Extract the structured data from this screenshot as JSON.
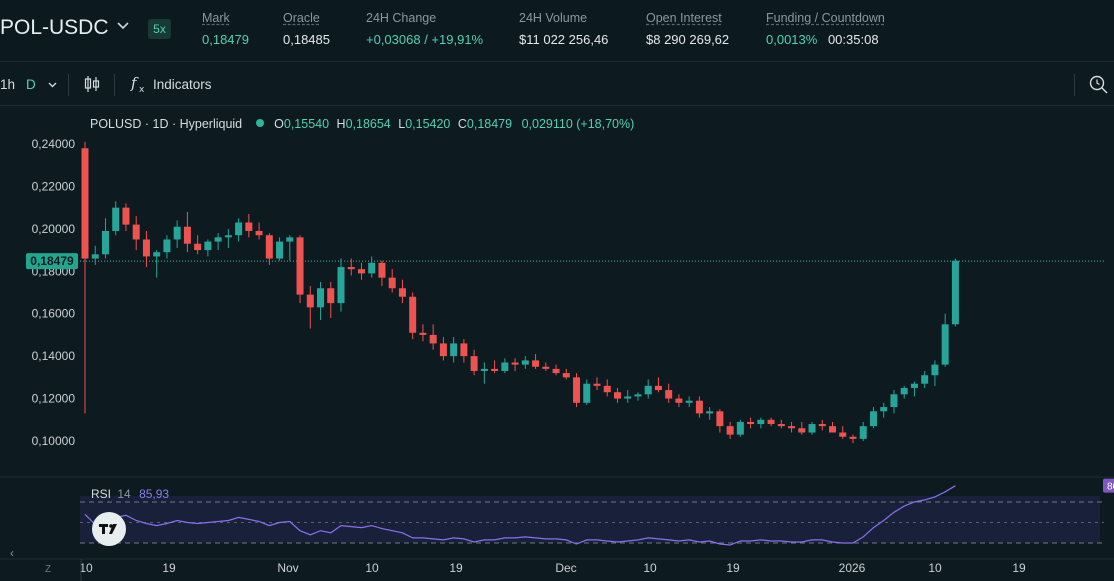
{
  "header": {
    "pair": "POL-USDC",
    "leverage": "5x",
    "stats": [
      {
        "label": "Mark",
        "value": "0,18479",
        "green": true
      },
      {
        "label": "Oracle",
        "value": "0,18485",
        "green": false
      },
      {
        "label": "24H Change",
        "value": "+0,03068 / +19,91%",
        "green": true
      },
      {
        "label": "24H Volume",
        "value": "$11 022 256,46",
        "green": false
      },
      {
        "label": "Open Interest",
        "value": "$8 290 269,62",
        "green": false
      },
      {
        "label": "Funding / Countdown",
        "value": "0,0013%",
        "value2": "00:35:08",
        "green": true
      }
    ]
  },
  "toolbar": {
    "interval_1h": "1h",
    "interval_d": "D",
    "indicators_label": "Indicators"
  },
  "legend": {
    "symbol": "POLUSD · 1D · Hyperliquid",
    "o_label": "O",
    "o": "0,15540",
    "h_label": "H",
    "h": "0,18654",
    "l_label": "L",
    "l": "0,15420",
    "c_label": "C",
    "c": "0,18479",
    "change": "0,029110 (+18,70%)"
  },
  "rsi": {
    "label": "RSI",
    "period": "14",
    "value": "85,93"
  },
  "price_label": "0,18479",
  "colors": {
    "up": "#26a69a",
    "down": "#ef5350",
    "rsi": "#7e57c2",
    "bg": "#0d1a20"
  },
  "chart_data": {
    "type": "candlestick",
    "y_ticks": [
      "0,24000",
      "0,22000",
      "0,20000",
      "0,18000",
      "0,16000",
      "0,14000",
      "0,12000",
      "0,10000"
    ],
    "x_labels": [
      "10",
      "19",
      "Nov",
      "10",
      "19",
      "Dec",
      "10",
      "19",
      "2026",
      "10",
      "19"
    ],
    "ylim": [
      0.0935,
      0.245
    ],
    "candles": [
      [
        0.238,
        0.241,
        0.113,
        0.186
      ],
      [
        0.186,
        0.192,
        0.183,
        0.188
      ],
      [
        0.188,
        0.205,
        0.186,
        0.199
      ],
      [
        0.199,
        0.213,
        0.197,
        0.21
      ],
      [
        0.21,
        0.212,
        0.199,
        0.202
      ],
      [
        0.202,
        0.206,
        0.19,
        0.195
      ],
      [
        0.195,
        0.199,
        0.182,
        0.187
      ],
      [
        0.187,
        0.19,
        0.177,
        0.189
      ],
      [
        0.189,
        0.197,
        0.186,
        0.195
      ],
      [
        0.195,
        0.204,
        0.191,
        0.201
      ],
      [
        0.201,
        0.208,
        0.189,
        0.193
      ],
      [
        0.193,
        0.197,
        0.188,
        0.19
      ],
      [
        0.19,
        0.195,
        0.187,
        0.194
      ],
      [
        0.194,
        0.198,
        0.19,
        0.196
      ],
      [
        0.196,
        0.2,
        0.191,
        0.197
      ],
      [
        0.197,
        0.205,
        0.194,
        0.203
      ],
      [
        0.203,
        0.207,
        0.196,
        0.199
      ],
      [
        0.199,
        0.203,
        0.195,
        0.197
      ],
      [
        0.197,
        0.198,
        0.183,
        0.186
      ],
      [
        0.186,
        0.196,
        0.185,
        0.194
      ],
      [
        0.194,
        0.197,
        0.185,
        0.196
      ],
      [
        0.196,
        0.197,
        0.165,
        0.169
      ],
      [
        0.169,
        0.173,
        0.153,
        0.163
      ],
      [
        0.163,
        0.175,
        0.157,
        0.172
      ],
      [
        0.172,
        0.175,
        0.158,
        0.165
      ],
      [
        0.165,
        0.186,
        0.161,
        0.182
      ],
      [
        0.182,
        0.186,
        0.178,
        0.181
      ],
      [
        0.181,
        0.184,
        0.176,
        0.179
      ],
      [
        0.179,
        0.187,
        0.177,
        0.184
      ],
      [
        0.184,
        0.185,
        0.173,
        0.177
      ],
      [
        0.177,
        0.181,
        0.17,
        0.172
      ],
      [
        0.172,
        0.176,
        0.165,
        0.168
      ],
      [
        0.168,
        0.17,
        0.148,
        0.151
      ],
      [
        0.151,
        0.155,
        0.147,
        0.15
      ],
      [
        0.15,
        0.155,
        0.143,
        0.146
      ],
      [
        0.146,
        0.149,
        0.138,
        0.14
      ],
      [
        0.14,
        0.149,
        0.137,
        0.146
      ],
      [
        0.146,
        0.148,
        0.137,
        0.14
      ],
      [
        0.14,
        0.143,
        0.131,
        0.133
      ],
      [
        0.133,
        0.137,
        0.127,
        0.134
      ],
      [
        0.134,
        0.138,
        0.132,
        0.133
      ],
      [
        0.133,
        0.139,
        0.132,
        0.137
      ],
      [
        0.137,
        0.139,
        0.133,
        0.136
      ],
      [
        0.136,
        0.14,
        0.134,
        0.138
      ],
      [
        0.138,
        0.141,
        0.134,
        0.135
      ],
      [
        0.135,
        0.137,
        0.133,
        0.134
      ],
      [
        0.134,
        0.136,
        0.131,
        0.132
      ],
      [
        0.132,
        0.134,
        0.129,
        0.13
      ],
      [
        0.13,
        0.132,
        0.116,
        0.118
      ],
      [
        0.118,
        0.129,
        0.117,
        0.127
      ],
      [
        0.127,
        0.13,
        0.124,
        0.126
      ],
      [
        0.126,
        0.129,
        0.121,
        0.123
      ],
      [
        0.123,
        0.125,
        0.118,
        0.12
      ],
      [
        0.12,
        0.124,
        0.118,
        0.121
      ],
      [
        0.121,
        0.123,
        0.119,
        0.122
      ],
      [
        0.122,
        0.129,
        0.12,
        0.126
      ],
      [
        0.126,
        0.13,
        0.123,
        0.124
      ],
      [
        0.124,
        0.127,
        0.118,
        0.12
      ],
      [
        0.12,
        0.122,
        0.116,
        0.118
      ],
      [
        0.118,
        0.121,
        0.116,
        0.119
      ],
      [
        0.119,
        0.121,
        0.111,
        0.113
      ],
      [
        0.113,
        0.116,
        0.11,
        0.114
      ],
      [
        0.114,
        0.115,
        0.104,
        0.107
      ],
      [
        0.107,
        0.109,
        0.101,
        0.103
      ],
      [
        0.103,
        0.11,
        0.102,
        0.109
      ],
      [
        0.109,
        0.111,
        0.106,
        0.108
      ],
      [
        0.108,
        0.111,
        0.106,
        0.11
      ],
      [
        0.11,
        0.111,
        0.107,
        0.108
      ],
      [
        0.108,
        0.11,
        0.106,
        0.107
      ],
      [
        0.107,
        0.109,
        0.104,
        0.106
      ],
      [
        0.106,
        0.109,
        0.103,
        0.104
      ],
      [
        0.104,
        0.109,
        0.103,
        0.108
      ],
      [
        0.108,
        0.11,
        0.105,
        0.107
      ],
      [
        0.107,
        0.109,
        0.104,
        0.104
      ],
      [
        0.104,
        0.107,
        0.101,
        0.102
      ],
      [
        0.102,
        0.103,
        0.099,
        0.101
      ],
      [
        0.101,
        0.109,
        0.1,
        0.107
      ],
      [
        0.107,
        0.116,
        0.106,
        0.114
      ],
      [
        0.114,
        0.118,
        0.111,
        0.116
      ],
      [
        0.116,
        0.124,
        0.113,
        0.122
      ],
      [
        0.122,
        0.126,
        0.12,
        0.125
      ],
      [
        0.125,
        0.128,
        0.121,
        0.127
      ],
      [
        0.127,
        0.133,
        0.125,
        0.131
      ],
      [
        0.131,
        0.138,
        0.126,
        0.136
      ],
      [
        0.136,
        0.16,
        0.135,
        0.155
      ],
      [
        0.155,
        0.186,
        0.154,
        0.185
      ]
    ],
    "rsi_levels": [
      "70",
      "30"
    ],
    "rsi_ylim": [
      0,
      100
    ],
    "rsi_values": [
      58,
      48,
      50,
      55,
      57,
      52,
      49,
      47,
      49,
      52,
      50,
      49,
      50,
      51,
      52,
      55,
      53,
      51,
      47,
      50,
      51,
      42,
      38,
      42,
      40,
      47,
      46,
      45,
      47,
      44,
      42,
      40,
      35,
      35,
      34,
      33,
      35,
      34,
      31,
      33,
      33,
      35,
      35,
      36,
      35,
      34,
      34,
      33,
      29,
      33,
      33,
      32,
      31,
      32,
      33,
      35,
      34,
      33,
      32,
      33,
      31,
      32,
      29,
      28,
      32,
      32,
      33,
      32,
      32,
      31,
      31,
      33,
      33,
      31,
      30,
      30,
      36,
      45,
      52,
      60,
      66,
      70,
      72,
      75,
      80,
      85.93
    ]
  }
}
